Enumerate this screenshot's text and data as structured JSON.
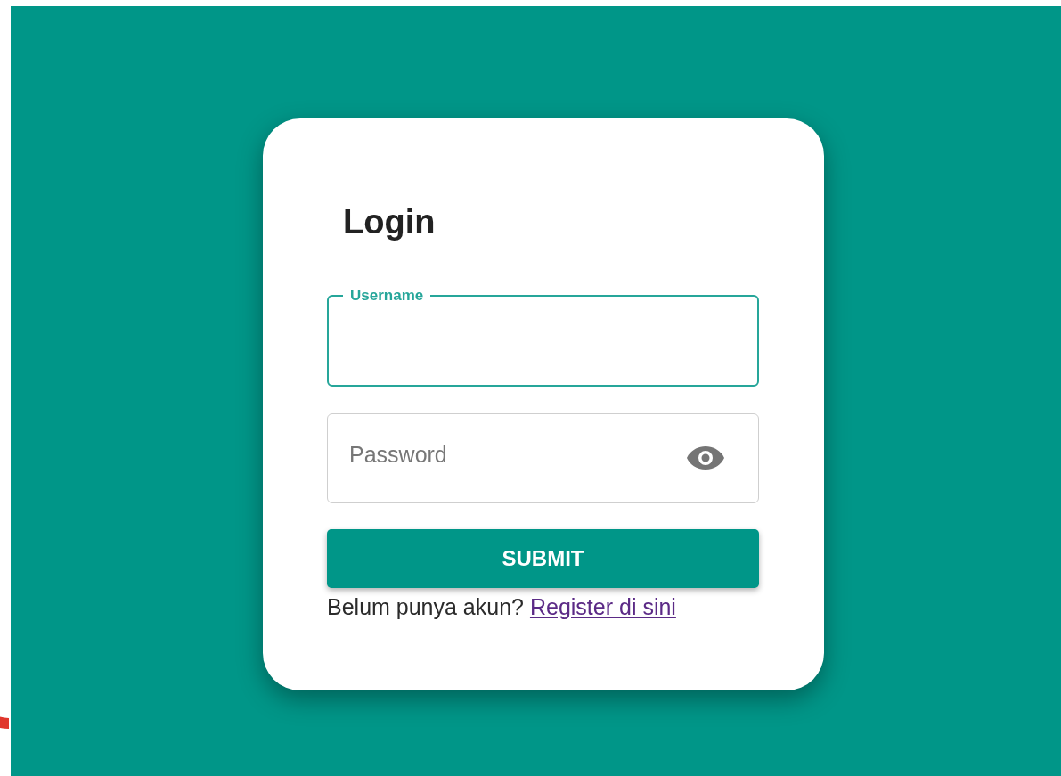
{
  "login_card": {
    "title": "Login",
    "username_field": {
      "label": "Username",
      "focused": true
    },
    "password_field": {
      "placeholder": "Password"
    },
    "submit_button": "SUBMIT",
    "register_prompt": {
      "text": "Belum punya akun?",
      "link": "Register di sini"
    }
  }
}
